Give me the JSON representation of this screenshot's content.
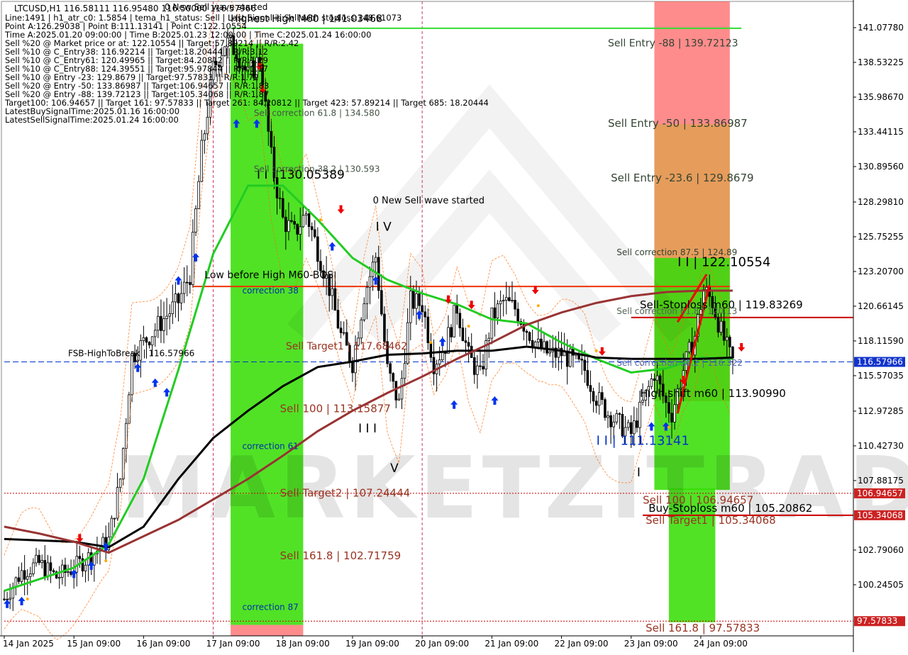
{
  "symbol_line": "LTCUSD,H1  116.58111 116.95480 116.50000 116.57966",
  "info_lines": [
    "Line:1491 | h1_atr_c0: 1.5854 | tema_h1_status: Sell | Last Signal is:Sell with stoploss:148.61073",
    "Point A:126.29038 | Point B:111.13141 | Point C:122.10554",
    "Time A:2025.01.20 09:00:00 | Time B:2025.01.23 12:00:00 | Time C:2025.01.24 16:00:00",
    "Sell %20 @ Market price or at: 122.10554 || Target:57.89214 || R/R:2.42",
    "Sell %10 @ C_Entry38: 116.92214 || Target:18.20444 || R/R:3.12",
    "Sell %10 @ C_Entry61: 120.49965 || Target:84.20812 || R/R:1.29",
    "Sell %10 @ C_Entry88: 124.39551 || Target:95.97844 || R/R:1.17",
    "Sell %10 @ Entry -23: 129.8679 || Target:97.57833 || R/R:1.72",
    "Sell %20 @ Entry -50: 133.86987 || Target:106.94657 || R/R:1.83",
    "Sell %20 @ Entry -88: 139.72123 || Target:105.34068 || R/R:1.87",
    "Target100: 106.94657 || Target 161: 97.57833 || Target 261: 84.20812 || Target 423: 57.89214 || Target 685: 18.20444",
    "LatestBuySignalTime:2025.01.16 16:00:00",
    "LatestSellSignalTime:2025.01.24 16:00:00"
  ],
  "header_overlay": "0 New Sell wave started",
  "colors": {
    "bull_candle": "#000000",
    "bear_candle": "#000000",
    "green_zone": "#33dd00",
    "red_zone": "#ff6666",
    "ma_green": "#22cc22",
    "ma_black": "#000000",
    "ma_brown": "#993333",
    "level_red": "#cc0000",
    "level_blue": "#0033cc",
    "arrow_up": "#0033ee",
    "arrow_down": "#ee0000",
    "price_tag_bg": "#cc2222",
    "current_tag_bg": "#1133cc"
  },
  "chart_data": {
    "type": "candlestick",
    "title": "LTCUSD,H1",
    "price_axis": {
      "min": 96.5,
      "max": 143.0,
      "ticks": [
        141.0778,
        138.53225,
        135.9867,
        133.44115,
        130.8956,
        128.2981,
        125.75255,
        123.207,
        120.66145,
        118.1159,
        115.57035,
        112.97285,
        110.4273,
        107.88175,
        102.7906,
        100.24505
      ],
      "tick_labels": [
        "141.07780",
        "138.53225",
        "135.98670",
        "133.44115",
        "130.89560",
        "128.29810",
        "125.75255",
        "123.20700",
        "120.66145",
        "118.11590",
        "115.57035",
        "112.97285",
        "110.42730",
        "107.88175",
        "102.79060",
        "100.24505"
      ]
    },
    "time_axis": {
      "labels": [
        "14 Jan 2025",
        "15 Jan 09:00",
        "16 Jan 09:00",
        "17 Jan 09:00",
        "18 Jan 09:00",
        "19 Jan 09:00",
        "20 Jan 09:00",
        "21 Jan 09:00",
        "22 Jan 09:00",
        "23 Jan 09:00",
        "24 Jan 09:00"
      ],
      "bars_per_label": 24,
      "first_label_bar": 0,
      "total_bars": 252
    },
    "ohlc_path": [
      [
        0,
        99.2
      ],
      [
        6,
        101.2
      ],
      [
        12,
        101.8
      ],
      [
        18,
        100.8
      ],
      [
        24,
        101.5
      ],
      [
        30,
        102.4
      ],
      [
        36,
        103.5
      ],
      [
        40,
        108.0
      ],
      [
        44,
        117.0
      ],
      [
        48,
        118.0
      ],
      [
        54,
        119.5
      ],
      [
        60,
        121.0
      ],
      [
        64,
        123.0
      ],
      [
        68,
        132.0
      ],
      [
        72,
        138.0
      ],
      [
        76,
        140.0
      ],
      [
        80,
        139.5
      ],
      [
        84,
        137.5
      ],
      [
        88,
        138.8
      ],
      [
        92,
        131.5
      ],
      [
        96,
        127.0
      ],
      [
        100,
        126.0
      ],
      [
        104,
        127.5
      ],
      [
        108,
        124.8
      ],
      [
        112,
        122.0
      ],
      [
        116,
        118.5
      ],
      [
        120,
        116.5
      ],
      [
        124,
        121.5
      ],
      [
        128,
        124.3
      ],
      [
        132,
        116.0
      ],
      [
        136,
        113.5
      ],
      [
        140,
        121.0
      ],
      [
        144,
        120.8
      ],
      [
        148,
        116.5
      ],
      [
        152,
        117.8
      ],
      [
        156,
        120.6
      ],
      [
        160,
        117.0
      ],
      [
        164,
        115.5
      ],
      [
        168,
        119.8
      ],
      [
        172,
        121.0
      ],
      [
        176,
        120.5
      ],
      [
        180,
        119.0
      ],
      [
        184,
        117.7
      ],
      [
        188,
        117.1
      ],
      [
        192,
        117.2
      ],
      [
        196,
        116.6
      ],
      [
        200,
        116.0
      ],
      [
        204,
        114.0
      ],
      [
        208,
        112.8
      ],
      [
        212,
        112.0
      ],
      [
        216,
        111.3
      ],
      [
        220,
        113.5
      ],
      [
        224,
        115.8
      ],
      [
        228,
        113.5
      ],
      [
        230,
        112.8
      ],
      [
        234,
        116.0
      ],
      [
        238,
        118.5
      ],
      [
        241,
        121.9
      ],
      [
        244,
        121.0
      ],
      [
        247,
        118.8
      ],
      [
        250,
        117.0
      ],
      [
        251,
        116.58
      ]
    ],
    "moving_averages": [
      {
        "name": "green",
        "points": [
          [
            0,
            99.8
          ],
          [
            24,
            101.5
          ],
          [
            36,
            103.2
          ],
          [
            48,
            108.0
          ],
          [
            60,
            116.0
          ],
          [
            72,
            124.5
          ],
          [
            84,
            129.5
          ],
          [
            96,
            129.5
          ],
          [
            108,
            127.0
          ],
          [
            120,
            124.2
          ],
          [
            132,
            122.6
          ],
          [
            144,
            121.6
          ],
          [
            156,
            120.8
          ],
          [
            168,
            119.7
          ],
          [
            180,
            119.4
          ],
          [
            192,
            118.0
          ],
          [
            204,
            116.8
          ],
          [
            216,
            115.8
          ],
          [
            228,
            116.1
          ],
          [
            240,
            116.9
          ],
          [
            251,
            116.8
          ]
        ]
      },
      {
        "name": "black",
        "points": [
          [
            0,
            103.6
          ],
          [
            24,
            103.4
          ],
          [
            36,
            103.0
          ],
          [
            48,
            104.5
          ],
          [
            60,
            108.0
          ],
          [
            72,
            111.0
          ],
          [
            84,
            113.0
          ],
          [
            96,
            114.8
          ],
          [
            108,
            116.2
          ],
          [
            120,
            116.6
          ],
          [
            132,
            117.1
          ],
          [
            144,
            117.2
          ],
          [
            156,
            117.4
          ],
          [
            168,
            117.4
          ],
          [
            180,
            117.7
          ],
          [
            192,
            117.4
          ],
          [
            204,
            116.9
          ],
          [
            216,
            116.8
          ],
          [
            228,
            116.8
          ],
          [
            240,
            116.8
          ],
          [
            251,
            116.9
          ]
        ]
      },
      {
        "name": "brown",
        "points": [
          [
            0,
            104.5
          ],
          [
            12,
            104.0
          ],
          [
            24,
            103.4
          ],
          [
            36,
            102.6
          ],
          [
            48,
            103.8
          ],
          [
            60,
            105.0
          ],
          [
            72,
            106.5
          ],
          [
            84,
            108.0
          ],
          [
            96,
            109.7
          ],
          [
            108,
            111.5
          ],
          [
            120,
            113.0
          ],
          [
            132,
            114.3
          ],
          [
            144,
            115.5
          ],
          [
            156,
            116.8
          ],
          [
            168,
            118.0
          ],
          [
            180,
            119.3
          ],
          [
            192,
            120.2
          ],
          [
            204,
            120.9
          ],
          [
            216,
            121.4
          ],
          [
            228,
            121.7
          ],
          [
            240,
            121.8
          ],
          [
            251,
            121.8
          ]
        ]
      }
    ],
    "zones": [
      {
        "color": "green",
        "bar_from": 78,
        "bar_to": 103,
        "price_from": 97.3,
        "price_to": 139.9
      },
      {
        "color": "red",
        "bar_from": 78,
        "bar_to": 103,
        "price_from": 96.5,
        "price_to": 97.3
      },
      {
        "color": "red",
        "bar_from": 224,
        "bar_to": 250,
        "price_from": 113.7,
        "price_to": 143.0
      },
      {
        "color": "green",
        "bar_from": 224,
        "bar_to": 250,
        "price_from": 107.2,
        "price_to": 124.2
      },
      {
        "color": "green",
        "bar_from": 229,
        "bar_to": 245,
        "price_from": 97.5,
        "price_to": 107.3
      }
    ],
    "horizontal_levels": [
      {
        "price": 141.03468,
        "bar_from": 78,
        "bar_to": 254,
        "color": "#33dd33",
        "width": 2
      },
      {
        "price": 122.10554,
        "bar_from": 65,
        "bar_to": 250,
        "color": "#ee3300",
        "width": 2
      },
      {
        "price": 119.83269,
        "bar_from": 216,
        "bar_to": 300,
        "color": "#cc0000",
        "width": 2
      },
      {
        "price": 116.57966,
        "bar_from": 0,
        "bar_to": 300,
        "color": "#0033cc",
        "width": 1,
        "dash": "8,4"
      },
      {
        "price": 106.94657,
        "bar_from": 0,
        "bar_to": 300,
        "color": "#cc0000",
        "width": 1,
        "dash": "2,2"
      },
      {
        "price": 105.34068,
        "bar_from": 220,
        "bar_to": 300,
        "color": "#cc0000",
        "width": 2
      },
      {
        "price": 97.57833,
        "bar_from": 0,
        "bar_to": 300,
        "color": "#cc0000",
        "width": 1,
        "dash": "2,2"
      }
    ],
    "price_tags": [
      {
        "label": "106.94657",
        "price": 106.94657,
        "kind": "red"
      },
      {
        "label": "105.34068",
        "price": 105.34068,
        "kind": "red"
      },
      {
        "label": "116.57966",
        "price": 116.57966,
        "kind": "blue"
      },
      {
        "label": "97.57833",
        "price": 97.57833,
        "kind": "red"
      }
    ],
    "annotations": [
      {
        "text": "Highest High   M60 | 141.03468",
        "bar": 78,
        "price": 141.5,
        "color": "#000000",
        "size": 14
      },
      {
        "text": "Sell Entry -88 | 139.72123",
        "bar": 208,
        "price": 139.7,
        "color": "#334433",
        "size": 14
      },
      {
        "text": "Sell correction 61.8 | 134.580",
        "bar": 86,
        "price": 134.6,
        "color": "#445544",
        "size": 12
      },
      {
        "text": "Sell Entry -50 | 133.86987",
        "bar": 208,
        "price": 133.8,
        "color": "#334433",
        "size": 15
      },
      {
        "text": "I I | 130.05389",
        "bar": 87,
        "price": 130.0,
        "color": "#000000",
        "size": 17
      },
      {
        "text": "Sell correction 38.2 | 130.593",
        "bar": 86,
        "price": 130.5,
        "color": "#445544",
        "size": 12
      },
      {
        "text": "Sell Entry -23.6 | 129.8679",
        "bar": 209,
        "price": 129.8,
        "color": "#334433",
        "size": 15
      },
      {
        "text": "0 New Sell wave started",
        "bar": 127,
        "price": 128.2,
        "color": "#000000",
        "size": 13
      },
      {
        "text": "I V",
        "bar": 128,
        "price": 126.2,
        "color": "#000000",
        "size": 17
      },
      {
        "text": "Sell correction 87.5 | 124.89",
        "bar": 211,
        "price": 124.4,
        "color": "#334433",
        "size": 12
      },
      {
        "text": "I I | 122.10554",
        "bar": 232,
        "price": 123.6,
        "color": "#000000",
        "size": 18
      },
      {
        "text": "Low before High   M60-BOS",
        "bar": 69,
        "price": 122.7,
        "color": "#000000",
        "size": 14
      },
      {
        "text": "correction 38",
        "bar": 82,
        "price": 121.6,
        "color": "#0033aa",
        "size": 12
      },
      {
        "text": "Sell-Stoploss m60 | 119.83269",
        "bar": 219,
        "price": 120.5,
        "color": "#000000",
        "size": 15
      },
      {
        "text": "Sell correction 61.8 | 120.13",
        "bar": 211,
        "price": 120.1,
        "color": "#556655",
        "size": 12
      },
      {
        "text": "FSB-HighToBreak | 116.57966",
        "bar": 22,
        "price": 117.0,
        "color": "#000000",
        "size": 12
      },
      {
        "text": "Sell Target1 | 117.68462",
        "bar": 97,
        "price": 117.5,
        "color": "#993322",
        "size": 14
      },
      {
        "text": "Sell correction 38.2 | 116.322",
        "bar": 211,
        "price": 116.3,
        "color": "#5566aa",
        "size": 12
      },
      {
        "text": "High shift m60 | 113.90990",
        "bar": 219,
        "price": 114.0,
        "color": "#000000",
        "size": 15
      },
      {
        "text": "Sell 100 | 113.15877",
        "bar": 95,
        "price": 112.9,
        "color": "#993322",
        "size": 15
      },
      {
        "text": "I I I",
        "bar": 122,
        "price": 111.4,
        "color": "#000000",
        "size": 17
      },
      {
        "text": "correction 61",
        "bar": 82,
        "price": 110.2,
        "color": "#0033aa",
        "size": 12
      },
      {
        "text": "I I | 111.13141",
        "bar": 204,
        "price": 110.5,
        "color": "#0033cc",
        "size": 18
      },
      {
        "text": "V",
        "bar": 133,
        "price": 108.5,
        "color": "#000000",
        "size": 17
      },
      {
        "text": "I",
        "bar": 218,
        "price": 108.2,
        "color": "#000000",
        "size": 17
      },
      {
        "text": "Sell Target2 | 107.24444",
        "bar": 95,
        "price": 106.7,
        "color": "#993322",
        "size": 15
      },
      {
        "text": "Sell 100 | 106.94657",
        "bar": 220,
        "price": 106.2,
        "color": "#993322",
        "size": 15
      },
      {
        "text": "Buy-Stoploss m60 | 105.20862",
        "bar": 222,
        "price": 105.6,
        "color": "#000000",
        "size": 15
      },
      {
        "text": "Sell Target1 | 105.34068",
        "bar": 221,
        "price": 104.7,
        "color": "#993322",
        "size": 15
      },
      {
        "text": "Sell 161.8 | 102.71759",
        "bar": 95,
        "price": 102.1,
        "color": "#993322",
        "size": 15
      },
      {
        "text": "correction 87",
        "bar": 82,
        "price": 98.4,
        "color": "#0033aa",
        "size": 12
      },
      {
        "text": "Sell 161.8 | 97.57833",
        "bar": 221,
        "price": 96.8,
        "color": "#993322",
        "size": 15
      }
    ],
    "buy_arrows": [
      [
        1,
        98.8
      ],
      [
        6,
        99.0
      ],
      [
        24,
        101.0
      ],
      [
        30,
        101.6
      ],
      [
        35,
        103.0
      ],
      [
        46,
        116.1
      ],
      [
        52,
        115.0
      ],
      [
        56,
        114.3
      ],
      [
        60,
        122.5
      ],
      [
        66,
        124.2
      ],
      [
        80,
        134.0
      ],
      [
        87,
        134.0
      ],
      [
        113,
        125.0
      ],
      [
        128,
        122.5
      ],
      [
        143,
        120.0
      ],
      [
        151,
        118.0
      ],
      [
        155,
        113.4
      ],
      [
        169,
        113.7
      ],
      [
        223,
        111.8
      ],
      [
        228,
        111.8
      ]
    ],
    "sell_arrows": [
      [
        26,
        103.7
      ],
      [
        88,
        138.3
      ],
      [
        89,
        136.6
      ],
      [
        116,
        127.8
      ],
      [
        153,
        121.2
      ],
      [
        161,
        120.8
      ],
      [
        183,
        121.9
      ],
      [
        206,
        117.4
      ],
      [
        234,
        115.3
      ],
      [
        254,
        117.7
      ]
    ],
    "small_markers": [
      [
        8,
        99.2
      ],
      [
        35,
        102.0
      ],
      [
        109,
        127.0
      ],
      [
        147,
        118.0
      ],
      [
        160,
        119.2
      ],
      [
        184,
        120.7
      ],
      [
        204,
        117.4
      ],
      [
        229,
        111.8
      ]
    ],
    "vertical_lines": [
      {
        "bar": 72,
        "color": "#cc3366"
      },
      {
        "bar": 144,
        "color": "#cc3366"
      }
    ],
    "watermark": "MARKETZITRADE"
  }
}
